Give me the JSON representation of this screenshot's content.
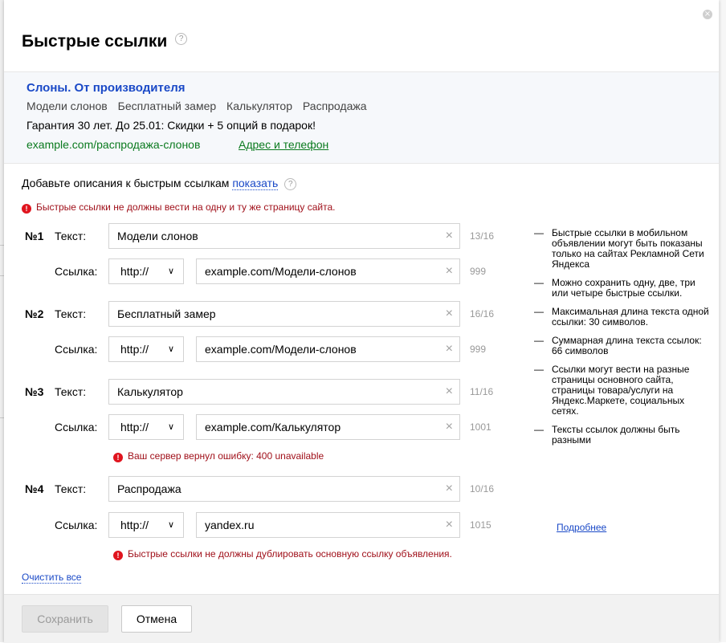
{
  "dialog": {
    "title": "Быстрые ссылки",
    "help_icon": "?",
    "close_icon": "×"
  },
  "preview": {
    "ad_title": "Слоны. От производителя",
    "sitelinks": [
      "Модели слонов",
      "Бесплатный замер",
      "Калькулятор",
      "Распродажа"
    ],
    "ad_text": "Гарантия 30 лет. До 25.01: Скидки + 5 опций в подарок!",
    "display_url": "example.com/распродажа-слонов",
    "contacts_link": "Адрес и телефон"
  },
  "descriptions": {
    "prompt": "Добавьте описания к быстрым ссылкам",
    "show_link": "показать",
    "help_icon": "?"
  },
  "errors": {
    "top": "Быстрые ссылки не должны вести на одну и ту же страницу сайта.",
    "link3": "Ваш сервер вернул ошибку: 400 unavailable",
    "link4": "Быстрые ссылки не должны дублировать основную ссылку объявления.",
    "icon": "!"
  },
  "labels": {
    "text": "Текст:",
    "link": "Ссылка:"
  },
  "links": [
    {
      "num": "№1",
      "text": "Модели слонов",
      "text_counter": "13/16",
      "protocol": "http://",
      "url": "example.com/Модели-слонов",
      "url_counter": "999"
    },
    {
      "num": "№2",
      "text": "Бесплатный замер",
      "text_counter": "16/16",
      "protocol": "http://",
      "url": "example.com/Модели-слонов",
      "url_counter": "999"
    },
    {
      "num": "№3",
      "text": "Калькулятор",
      "text_counter": "11/16",
      "protocol": "http://",
      "url": "example.com/Калькулятор",
      "url_counter": "1001"
    },
    {
      "num": "№4",
      "text": "Распродажа",
      "text_counter": "10/16",
      "protocol": "http://",
      "url": "yandex.ru",
      "url_counter": "1015"
    }
  ],
  "icons": {
    "clear": "×",
    "chevron": "∨"
  },
  "tips": {
    "dash": "—",
    "items": [
      "Быстрые ссылки в мобильном объявлении могут быть показаны только на сайтах Рекламной Сети Яндекса",
      "Можно сохранить одну, две, три или четыре быстрые ссылки.",
      "Максимальная длина текста одной ссылки: 30 символов.",
      "Суммарная длина текста ссылок: 66 символов",
      "Ссылки могут вести на разные страницы основного сайта, страницы товара/услуги на Яндекс.Маркете, социальных сетях.",
      "Тексты ссылок должны быть разными"
    ],
    "more_link": "Подробнее"
  },
  "actions": {
    "clear_all": "Очистить все",
    "save": "Сохранить",
    "cancel": "Отмена"
  }
}
